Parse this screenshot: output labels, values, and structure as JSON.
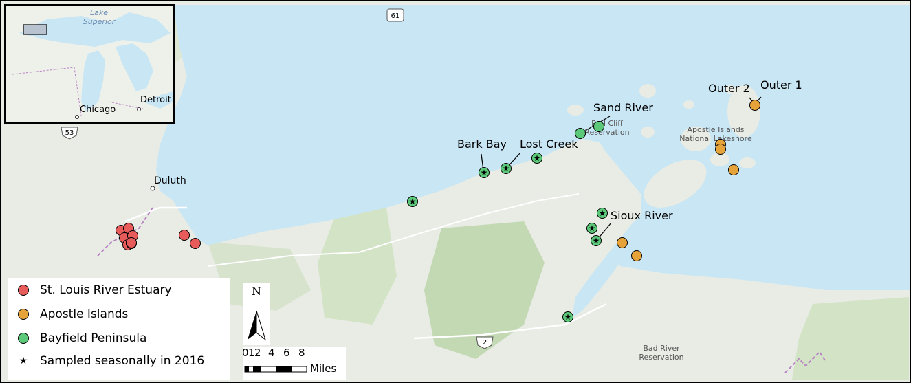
{
  "legend": {
    "items": [
      {
        "label": "St. Louis River Estuary",
        "color": "#e85b5b",
        "symbol": "circle"
      },
      {
        "label": "Apostle Islands",
        "color": "#e6a33a",
        "symbol": "circle"
      },
      {
        "label": "Bayfield Peninsula",
        "color": "#5cc97a",
        "symbol": "circle"
      },
      {
        "label": "Sampled seasonally in 2016",
        "color": "#000000",
        "symbol": "star"
      }
    ]
  },
  "site_labels": {
    "sand_river": "Sand River",
    "bark_bay": "Bark Bay",
    "lost_creek": "Lost Creek",
    "sioux_river": "Sioux River",
    "outer_2": "Outer 2",
    "outer_1": "Outer 1"
  },
  "places": {
    "duluth": "Duluth",
    "chicago": "Chicago",
    "detroit": "Detroit",
    "lake_superior": "Lake Superior"
  },
  "basemap_labels": {
    "red_cliff": "Red Cliff Reservation",
    "apostle_lakeshore": "Apostle Islands National Lakeshore",
    "bad_river": "Bad River Reservation"
  },
  "highways": {
    "hwy_61": "61",
    "hwy_53": "53",
    "hwy_2": "2"
  },
  "scale_bar": {
    "north": "N",
    "ticks": [
      "0",
      "1",
      "2",
      "4",
      "6",
      "8"
    ],
    "units": "Miles"
  },
  "colors": {
    "water": "#c9e6f5",
    "land": "#e8ece4",
    "forest": "#cfe0c0",
    "st_louis_river_estuary": "#e85b5b",
    "apostle_islands": "#e6a33a",
    "bayfield_peninsula": "#5cc97a"
  }
}
